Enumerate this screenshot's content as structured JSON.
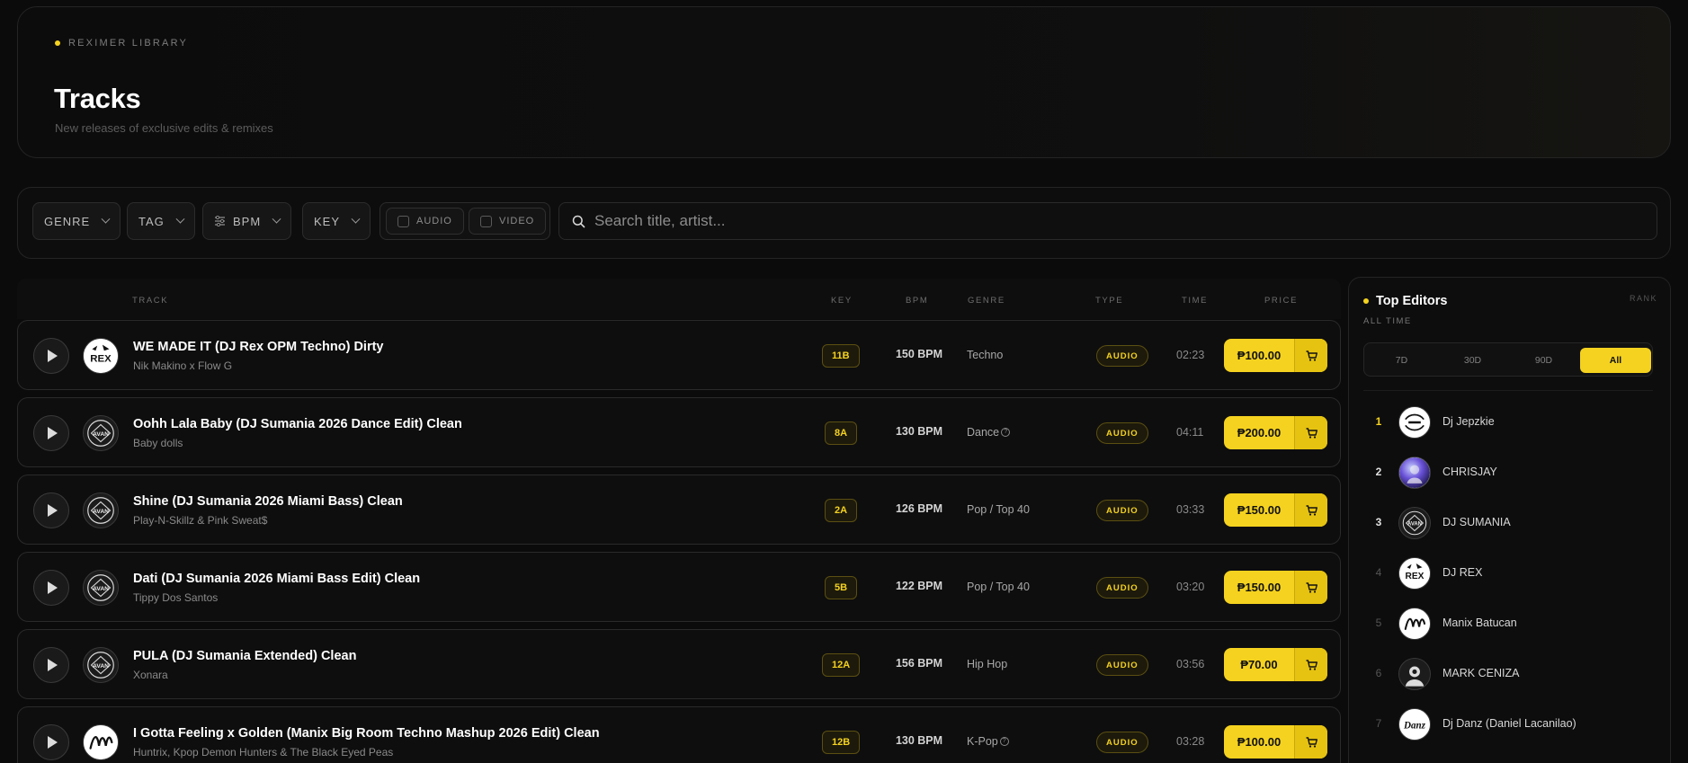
{
  "hero": {
    "eyebrow": "REXIMER LIBRARY",
    "title": "Tracks",
    "subtitle": "New releases of exclusive edits & remixes"
  },
  "filters": {
    "genre": "GENRE",
    "tag": "TAG",
    "bpm": "BPM",
    "key": "KEY",
    "audio": "AUDIO",
    "video": "VIDEO",
    "search_placeholder": "Search title, artist..."
  },
  "table": {
    "headers": {
      "track": "TRACK",
      "key": "KEY",
      "bpm": "BPM",
      "genre": "GENRE",
      "type": "TYPE",
      "time": "TIME",
      "price": "PRICE"
    },
    "rows": [
      {
        "title": "WE MADE IT (DJ Rex OPM Techno) Dirty",
        "artist": "Nik Makino x Flow G",
        "key": "11B",
        "bpm": "150 BPM",
        "genre": "Techno",
        "type": "AUDIO",
        "time": "02:23",
        "price": "₱100.00",
        "avatar": "rex-logo"
      },
      {
        "title": "Oohh Lala Baby (DJ Sumania 2026 Dance Edit) Clean",
        "artist": "Baby dolls",
        "key": "8A",
        "bpm": "130 BPM",
        "genre": "Dance",
        "type": "AUDIO",
        "time": "04:11",
        "price": "₱200.00",
        "avatar": "sumania-logo"
      },
      {
        "title": "Shine (DJ Sumania 2026 Miami Bass) Clean",
        "artist": "Play-N-Skillz & Pink Sweat$",
        "key": "2A",
        "bpm": "126 BPM",
        "genre": "Pop / Top 40",
        "type": "AUDIO",
        "time": "03:33",
        "price": "₱150.00",
        "avatar": "sumania-logo"
      },
      {
        "title": "Dati (DJ Sumania 2026 Miami Bass Edit) Clean",
        "artist": "Tippy Dos Santos",
        "key": "5B",
        "bpm": "122 BPM",
        "genre": "Pop / Top 40",
        "type": "AUDIO",
        "time": "03:20",
        "price": "₱150.00",
        "avatar": "sumania-logo"
      },
      {
        "title": "PULA (DJ Sumania Extended) Clean",
        "artist": "Xonara",
        "key": "12A",
        "bpm": "156 BPM",
        "genre": "Hip Hop",
        "type": "AUDIO",
        "time": "03:56",
        "price": "₱70.00",
        "avatar": "sumania-logo"
      },
      {
        "title": "I Gotta Feeling x Golden (Manix Big Room Techno Mashup 2026 Edit) Clean",
        "artist": "Huntrix, Kpop Demon Hunters & The Black Eyed Peas",
        "key": "12B",
        "bpm": "130 BPM",
        "genre": "K-Pop",
        "type": "AUDIO",
        "time": "03:28",
        "price": "₱100.00",
        "avatar": "manix-logo"
      }
    ]
  },
  "sidebar": {
    "title": "Top Editors",
    "rank_label": "RANK",
    "period_label": "ALL TIME",
    "ranges": [
      "7D",
      "30D",
      "90D",
      "All"
    ],
    "selected_range": "All",
    "editors": [
      {
        "rank": "1",
        "name": "Dj Jepzkie",
        "avatar": "jepzkie-logo"
      },
      {
        "rank": "2",
        "name": "CHRISJAY",
        "avatar": "chrisjay-photo"
      },
      {
        "rank": "3",
        "name": "DJ SUMANIA",
        "avatar": "sumania-logo"
      },
      {
        "rank": "4",
        "name": "DJ REX",
        "avatar": "rex-logo"
      },
      {
        "rank": "5",
        "name": "Manix Batucan",
        "avatar": "manix-logo"
      },
      {
        "rank": "6",
        "name": "MARK CENIZA",
        "avatar": "ceniza-logo"
      },
      {
        "rank": "7",
        "name": "Dj Danz (Daniel Lacanilao)",
        "avatar": "danz-logo"
      }
    ]
  },
  "colors": {
    "accent": "#f5d21f",
    "background": "#0b0b0b",
    "panel": "#0e0e0e"
  }
}
